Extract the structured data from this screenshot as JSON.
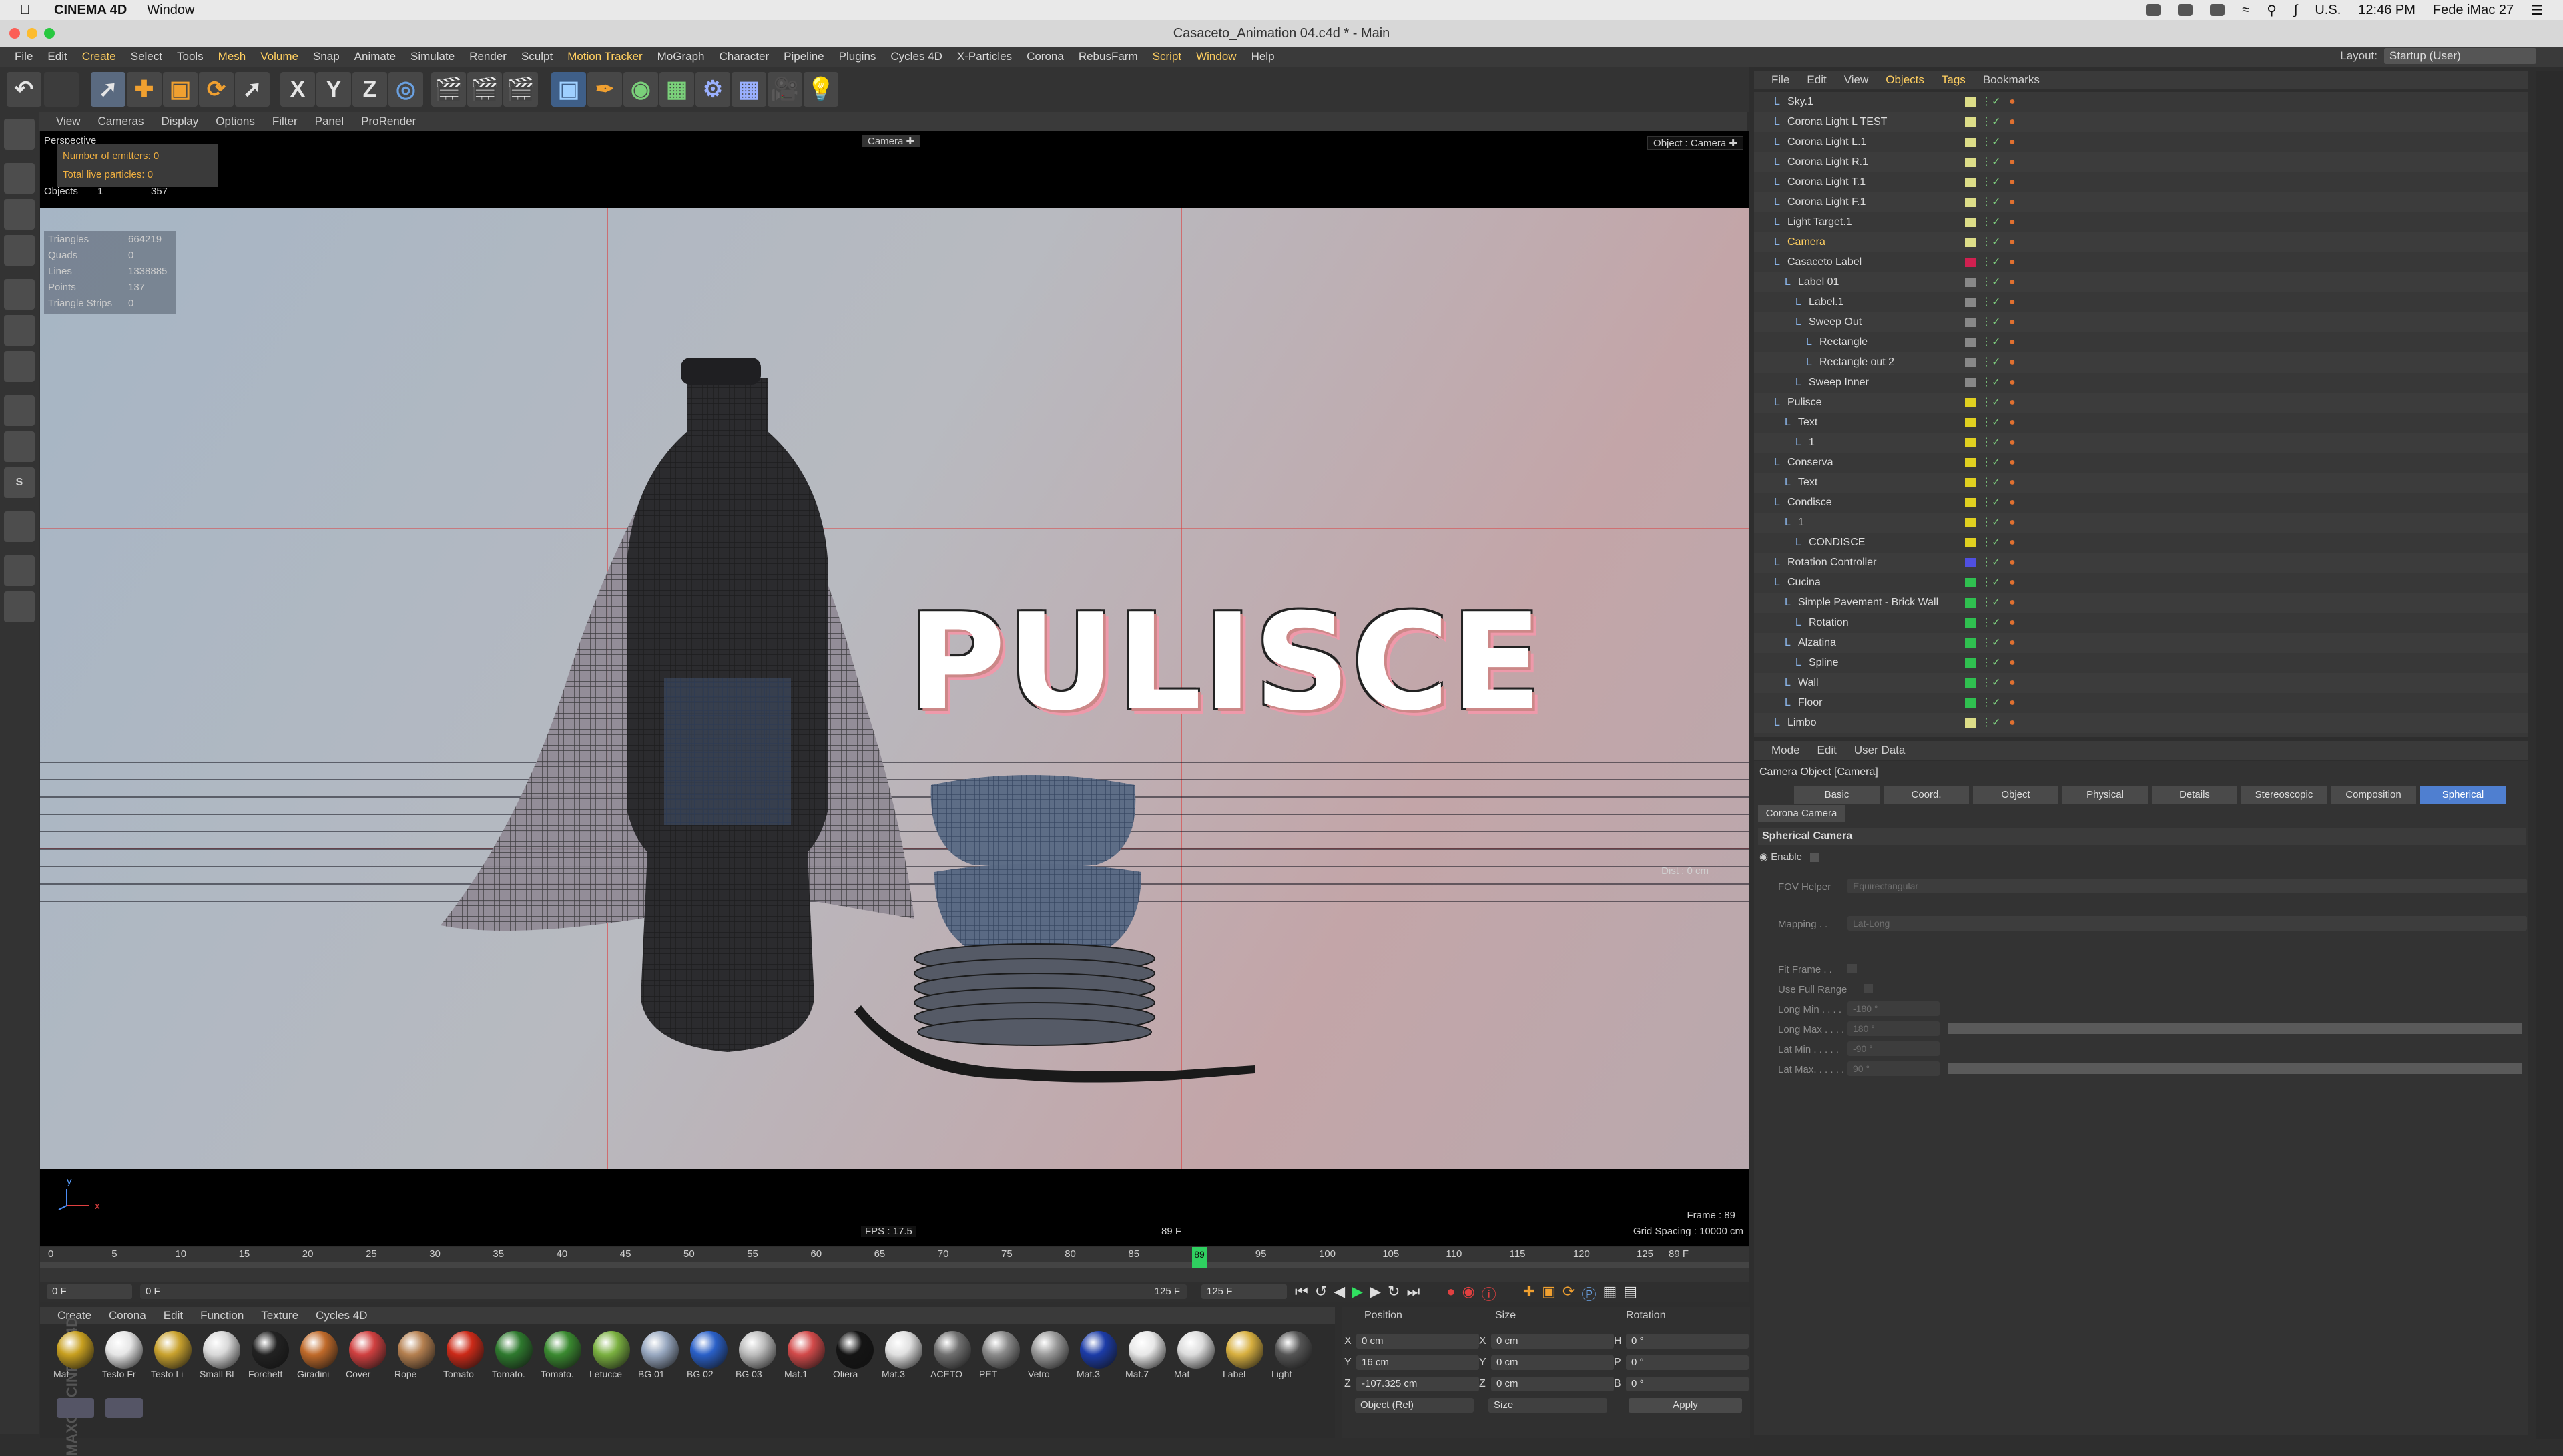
{
  "mac": {
    "app_name": "CINEMA 4D",
    "menu_window": "Window",
    "status_text": "U.S.",
    "time": "12:46 PM",
    "user": "Fede iMac 27"
  },
  "window": {
    "title": "Casaceto_Animation 04.c4d * - Main"
  },
  "menu": [
    "File",
    "Edit",
    "Create",
    "Select",
    "Tools",
    "Mesh",
    "Volume",
    "Snap",
    "Animate",
    "Simulate",
    "Render",
    "Sculpt",
    "Motion Tracker",
    "MoGraph",
    "Character",
    "Pipeline",
    "Plugins",
    "Cycles 4D",
    "X-Particles",
    "Corona",
    "RebusFarm",
    "Script",
    "Window",
    "Help"
  ],
  "menu_highlight": [
    "Create",
    "Mesh",
    "Volume",
    "Motion Tracker",
    "Script",
    "Window"
  ],
  "layout": {
    "label": "Layout:",
    "value": "Startup (User)"
  },
  "toolbar": {
    "x": "X",
    "y": "Y",
    "z": "Z"
  },
  "viewport": {
    "menu": [
      "View",
      "Cameras",
      "Display",
      "Options",
      "Filter",
      "Panel",
      "ProRender"
    ],
    "projection": "Perspective",
    "emitters": "Number of emitters: 0",
    "particles": "Total live particles: 0",
    "camera_label": "Camera",
    "object_camera": "Object : Camera",
    "objects_label": "Objects",
    "objects_sel": "1",
    "objects_count": "357",
    "stats": [
      {
        "k": "Triangles",
        "v": "664219"
      },
      {
        "k": "Quads",
        "v": "0"
      },
      {
        "k": "Lines",
        "v": "1338885"
      },
      {
        "k": "Points",
        "v": "137"
      },
      {
        "k": "Triangle Strips",
        "v": "0"
      }
    ],
    "scene_text": "PULISCE",
    "dist": "Dist : 0 cm",
    "fps": "FPS : 17.5",
    "frame_center": "89 F",
    "frame": "Frame : 89",
    "grid": "Grid Spacing : 10000 cm",
    "axis_y": "y",
    "axis_x": "x"
  },
  "timeline": {
    "ticks": [
      "0",
      "5",
      "10",
      "15",
      "20",
      "25",
      "30",
      "35",
      "40",
      "45",
      "50",
      "55",
      "60",
      "65",
      "70",
      "75",
      "80",
      "85",
      "90",
      "95",
      "100",
      "105",
      "110",
      "115",
      "120",
      "125"
    ],
    "current_marker": "89",
    "end_frame": "89 F",
    "start_field": "0 F",
    "range_start": "0 F",
    "range_end": "125 F",
    "end_field": "125 F"
  },
  "materials": {
    "menu": [
      "Create",
      "Corona",
      "Edit",
      "Function",
      "Texture",
      "Cycles 4D"
    ],
    "brand": "MAXON CINEMA 4D",
    "items": [
      {
        "label": "Mat",
        "color": "#c8a020"
      },
      {
        "label": "Testo Fr",
        "color": "#e6e6e6"
      },
      {
        "label": "Testo Li",
        "color": "#c9a22e"
      },
      {
        "label": "Small Bl",
        "color": "#d8d8d8"
      },
      {
        "label": "Forchett",
        "color": "#222222"
      },
      {
        "label": "Giradini",
        "color": "#c06a2a"
      },
      {
        "label": "Cover",
        "color": "#d04040"
      },
      {
        "label": "Rope",
        "color": "#b58050"
      },
      {
        "label": "Tomato",
        "color": "#cc2a18"
      },
      {
        "label": "Tomato.",
        "color": "#2e7a2e"
      },
      {
        "label": "Tomato.",
        "color": "#3a8a30"
      },
      {
        "label": "Letucce",
        "color": "#7ab040"
      },
      {
        "label": "BG 01",
        "color": "#98a8c0"
      },
      {
        "label": "BG 02",
        "color": "#2a60c8"
      },
      {
        "label": "BG 03",
        "color": "#bcbcbc"
      },
      {
        "label": "Mat.1",
        "color": "#d24a4a"
      },
      {
        "label": "Oliera",
        "color": "#141414"
      },
      {
        "label": "Mat.3",
        "color": "#e0e0e0"
      },
      {
        "label": "ACETO",
        "color": "#707070"
      },
      {
        "label": "PET",
        "color": "#8a8a8a"
      },
      {
        "label": "Vetro",
        "color": "#9a9a9a"
      },
      {
        "label": "Mat.3",
        "color": "#1c3ca8"
      },
      {
        "label": "Mat.7",
        "color": "#e8e8e8"
      },
      {
        "label": "Mat",
        "color": "#dcdcdc"
      },
      {
        "label": "Label",
        "color": "#d8b040"
      },
      {
        "label": "Light",
        "color": "#555555"
      }
    ]
  },
  "coords": {
    "headers": [
      "Position",
      "Size",
      "Rotation"
    ],
    "rows": [
      {
        "axis": "X",
        "pos": "0 cm",
        "saxis": "X",
        "size": "0 cm",
        "raxis": "H",
        "rot": "0 °"
      },
      {
        "axis": "Y",
        "pos": "16 cm",
        "saxis": "Y",
        "size": "0 cm",
        "raxis": "P",
        "rot": "0 °"
      },
      {
        "axis": "Z",
        "pos": "-107.325 cm",
        "saxis": "Z",
        "size": "0 cm",
        "raxis": "B",
        "rot": "0 °"
      }
    ],
    "mode": "Object (Rel)",
    "size_mode": "Size",
    "apply": "Apply"
  },
  "objects": {
    "menu": [
      "File",
      "Edit",
      "View",
      "Objects",
      "Tags",
      "Bookmarks"
    ],
    "rows": [
      {
        "name": "Sky.1",
        "indent": 0,
        "color": "#dddd88"
      },
      {
        "name": "Corona Light L TEST",
        "indent": 0,
        "color": "#dddd88"
      },
      {
        "name": "Corona Light L.1",
        "indent": 0,
        "color": "#dddd88"
      },
      {
        "name": "Corona Light R.1",
        "indent": 0,
        "color": "#dddd88"
      },
      {
        "name": "Corona Light T.1",
        "indent": 0,
        "color": "#dddd88"
      },
      {
        "name": "Corona Light F.1",
        "indent": 0,
        "color": "#dddd88"
      },
      {
        "name": "Light Target.1",
        "indent": 0,
        "color": "#dddd88"
      },
      {
        "name": "Camera",
        "indent": 0,
        "color": "#dddd88",
        "highlight": true
      },
      {
        "name": "Casaceto Label",
        "indent": 0,
        "color": "#d02050"
      },
      {
        "name": "Label 01",
        "indent": 1,
        "color": "#888888"
      },
      {
        "name": "Label.1",
        "indent": 2,
        "color": "#888888"
      },
      {
        "name": "Sweep Out",
        "indent": 2,
        "color": "#888888"
      },
      {
        "name": "Rectangle",
        "indent": 3,
        "color": "#888888"
      },
      {
        "name": "Rectangle out 2",
        "indent": 3,
        "color": "#888888"
      },
      {
        "name": "Sweep Inner",
        "indent": 2,
        "color": "#888888"
      },
      {
        "name": "Pulisce",
        "indent": 0,
        "color": "#e0d020"
      },
      {
        "name": "Text",
        "indent": 1,
        "color": "#e0d020"
      },
      {
        "name": "1",
        "indent": 2,
        "color": "#e0d020"
      },
      {
        "name": "Conserva",
        "indent": 0,
        "color": "#e0d020"
      },
      {
        "name": "Text",
        "indent": 1,
        "color": "#e0d020"
      },
      {
        "name": "Condisce",
        "indent": 0,
        "color": "#e0d020"
      },
      {
        "name": "1",
        "indent": 1,
        "color": "#e0d020"
      },
      {
        "name": "CONDISCE",
        "indent": 2,
        "color": "#e0d020"
      },
      {
        "name": "Rotation Controller",
        "indent": 0,
        "color": "#5050e0"
      },
      {
        "name": "Cucina",
        "indent": 0,
        "color": "#30c050"
      },
      {
        "name": "Simple Pavement - Brick Wall",
        "indent": 1,
        "color": "#30c050"
      },
      {
        "name": "Rotation",
        "indent": 2,
        "color": "#30c050"
      },
      {
        "name": "Alzatina",
        "indent": 1,
        "color": "#30c050"
      },
      {
        "name": "Spline",
        "indent": 2,
        "color": "#30c050"
      },
      {
        "name": "Wall",
        "indent": 1,
        "color": "#30c050"
      },
      {
        "name": "Floor",
        "indent": 1,
        "color": "#30c050"
      },
      {
        "name": "Limbo",
        "indent": 0,
        "color": "#dddd88"
      }
    ]
  },
  "attributes": {
    "menu": [
      "Mode",
      "Edit",
      "User Data"
    ],
    "object_title": "Camera Object [Camera]",
    "tabs": [
      "Basic",
      "Coord.",
      "Object",
      "Physical",
      "Details",
      "Stereoscopic",
      "Composition",
      "Spherical"
    ],
    "active_tab": "Spherical",
    "tab2": "Corona Camera",
    "section": "Spherical Camera",
    "enable": "Enable",
    "fov_helper_label": "FOV Helper",
    "fov_helper_value": "Equirectangular",
    "mapping_label": "Mapping . .",
    "mapping_value": "Lat-Long",
    "fit_frame": "Fit Frame . .",
    "use_full_range": "Use Full Range",
    "long_min_label": "Long Min . . . .",
    "long_min": "-180 °",
    "long_max_label": "Long Max . . . .",
    "long_max": "180 °",
    "lat_min_label": "Lat Min . . . . .",
    "lat_min": "-90 °",
    "lat_max_label": "Lat Max. . . . . .",
    "lat_max": "90 °"
  }
}
